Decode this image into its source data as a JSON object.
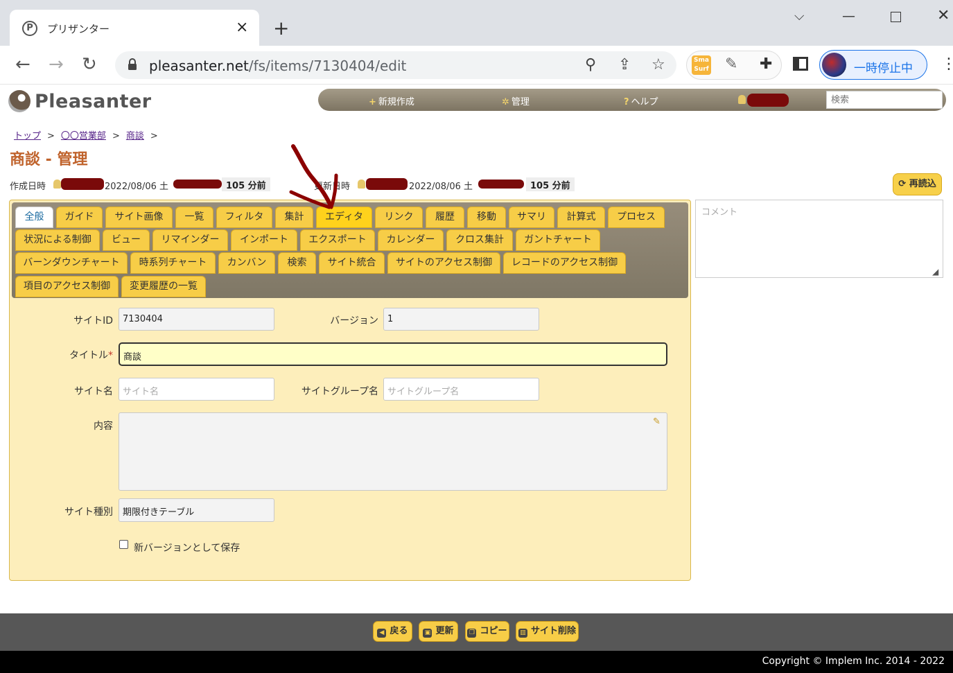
{
  "browser": {
    "tab_title": "プリザンター",
    "favicon_letter": "P",
    "url_host": "pleasanter.net",
    "url_path": "/fs/items/7130404/edit",
    "profile_label": "一時停止中"
  },
  "app": {
    "logo": "Pleasanter",
    "nav": {
      "new": "新規作成",
      "manage": "管理",
      "help": "ヘルプ"
    },
    "search_placeholder": "検索"
  },
  "breadcrumb": [
    "トップ",
    "〇〇営業部",
    "商談"
  ],
  "page_title": "商談 - 管理",
  "meta": {
    "created_label": "作成日時",
    "created_date": "2022/08/06 土",
    "created_ago": "105 分前",
    "updated_label": "更新日時",
    "updated_date": "2022/08/06 土",
    "updated_ago": "105 分前",
    "reload": "再読込"
  },
  "tabs": [
    [
      "全般",
      "ガイド",
      "サイト画像",
      "一覧",
      "フィルタ",
      "集計",
      "エディタ",
      "リンク",
      "履歴",
      "移動",
      "サマリ",
      "計算式",
      "プロセス"
    ],
    [
      "状況による制御",
      "ビュー",
      "リマインダー",
      "インポート",
      "エクスポート",
      "カレンダー",
      "クロス集計",
      "ガントチャート"
    ],
    [
      "バーンダウンチャート",
      "時系列チャート",
      "カンバン",
      "検索",
      "サイト統合",
      "サイトのアクセス制御",
      "レコードのアクセス制御"
    ],
    [
      "項目のアクセス制御",
      "変更履歴の一覧"
    ]
  ],
  "form": {
    "site_id_label": "サイトID",
    "site_id": "7130404",
    "version_label": "バージョン",
    "version": "1",
    "title_label": "タイトル",
    "title_required": "*",
    "title": "商談",
    "site_name_label": "サイト名",
    "site_name_placeholder": "サイト名",
    "site_group_label": "サイトグループ名",
    "site_group_placeholder": "サイトグループ名",
    "content_label": "内容",
    "site_type_label": "サイト種別",
    "site_type": "期限付きテーブル",
    "new_version_label": "新バージョンとして保存"
  },
  "comment_placeholder": "コメント",
  "footer": {
    "back": "戻る",
    "update": "更新",
    "copy": "コピー",
    "delete_site": "サイト削除",
    "copyright": "Copyright © Implem Inc. 2014 - 2022"
  },
  "colors": {
    "accent": "#f7cd47",
    "panel": "#fdeebb",
    "title": "#c0632c",
    "annotation": "#8b0000"
  }
}
